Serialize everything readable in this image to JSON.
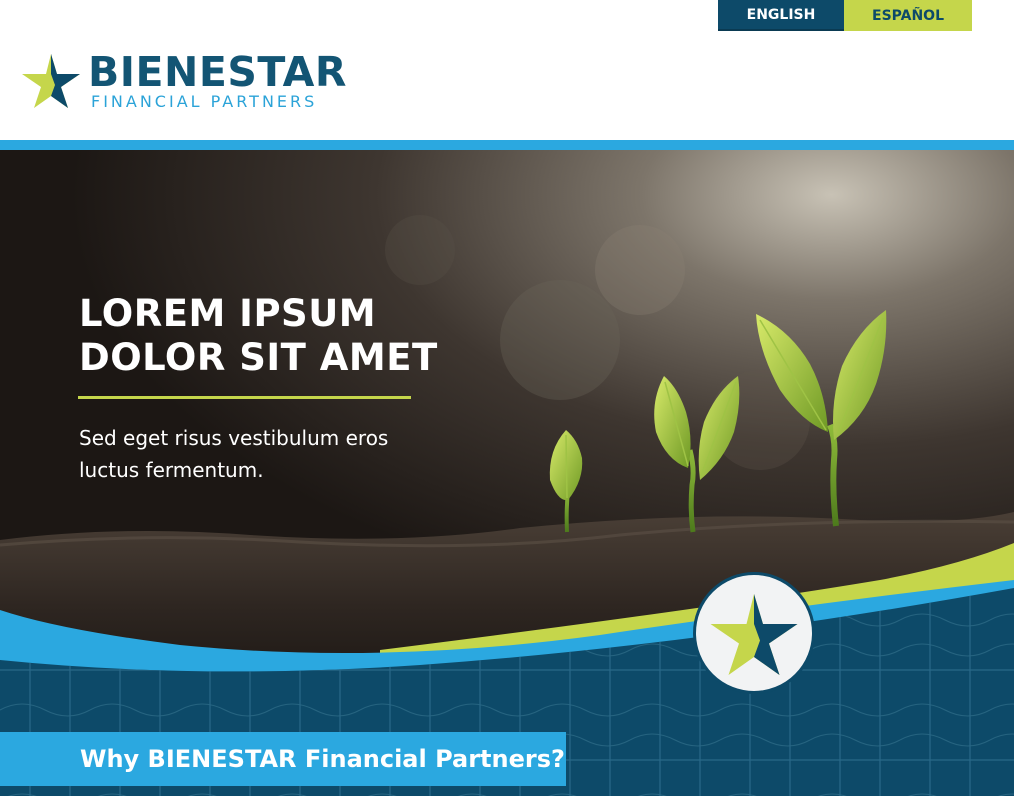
{
  "header": {
    "languages": [
      {
        "label": "ENGLISH",
        "active": true
      },
      {
        "label": "ESPAÑOL",
        "active": false
      }
    ],
    "logo": {
      "name": "BIENESTAR",
      "subtitle": "FINANCIAL PARTNERS",
      "icon": "star-icon"
    }
  },
  "hero": {
    "title_line1": "LOREM IPSUM",
    "title_line2": "DOLOR SIT AMET",
    "text": "Sed eget risus vestibulum eros luctus fermentum.",
    "badge_icon": "star-icon"
  },
  "section": {
    "heading": "Why BIENESTAR Financial Partners?"
  },
  "colors": {
    "navy": "#0d4a69",
    "lime": "#c5d64b",
    "sky": "#2ba8e0",
    "white": "#ffffff"
  }
}
